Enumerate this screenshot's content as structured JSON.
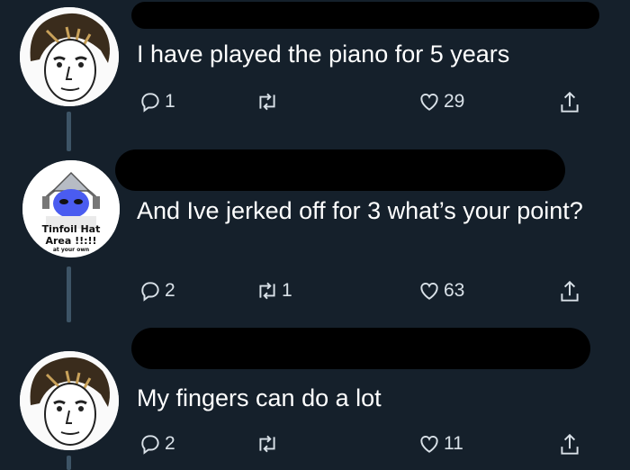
{
  "tweets": [
    {
      "text": "I have played the piano for 5 years",
      "reply_count": "1",
      "retweet_count": "",
      "like_count": "29"
    },
    {
      "text": "And Ive jerked off for 3 what’s your point?",
      "reply_count": "2",
      "retweet_count": "1",
      "like_count": "63",
      "avatar_text": {
        "line1": "Tinfoil Hat",
        "line2": "Area !!:!!",
        "line3": "at your own"
      }
    },
    {
      "text": "My fingers can do a lot",
      "reply_count": "2",
      "retweet_count": "",
      "like_count": "11"
    }
  ],
  "icons": [
    "reply-icon",
    "retweet-icon",
    "like-icon",
    "share-icon"
  ],
  "colors": {
    "background": "#15202b",
    "text": "#ffffff",
    "icon": "#8899a6",
    "thread_line": "#3d5466"
  }
}
